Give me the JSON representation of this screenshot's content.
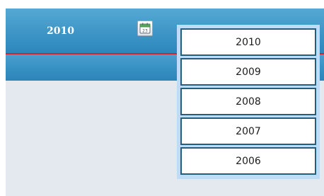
{
  "header": {
    "selected_year": "2010",
    "calendar_icon": "calendar-icon",
    "calendar_icon_number": "23"
  },
  "year_dropdown": {
    "options": [
      "2010",
      "2009",
      "2008",
      "2007",
      "2006"
    ]
  },
  "colors": {
    "header_blue": "#3d95c6",
    "accent_red": "#d8202a",
    "dropdown_frame": "#bfdcf7",
    "item_border": "#245e7e",
    "panel_background": "#e3e9ee"
  }
}
